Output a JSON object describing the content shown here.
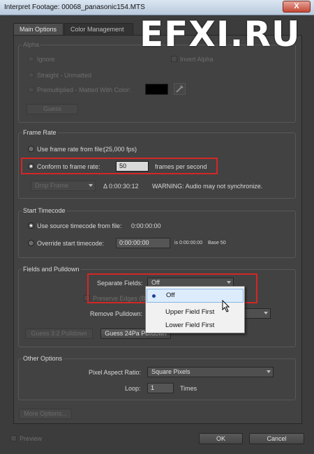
{
  "window": {
    "title": "Interpret Footage: 00068_panasonic154.MTS",
    "close_label": "X"
  },
  "watermark": "EFXI.RU",
  "tabs": [
    {
      "label": "Main Options",
      "active": true
    },
    {
      "label": "Color Management",
      "active": false
    }
  ],
  "alpha": {
    "title": "Alpha",
    "ignore": "Ignore",
    "invert": "Invert Alpha",
    "straight": "Straight - Unmatted",
    "premultiplied": "Premultiplied - Matted With Color:",
    "matte_color": "#000000",
    "guess": "Guess"
  },
  "frame_rate": {
    "title": "Frame Rate",
    "use_file": "Use frame rate from file:",
    "file_fps": "(25,000 fps)",
    "conform": "Conform to frame rate:",
    "conform_value": "50",
    "unit": "frames per second",
    "drop_frame": "Drop Frame",
    "delta": "Δ 0:00:30:12",
    "warning": "WARNING: Audio may not synchronize."
  },
  "start_timecode": {
    "title": "Start Timecode",
    "use_source": "Use source timecode from file:",
    "source_value": "0:00:00:00",
    "override": "Override start timecode:",
    "override_value": "0:00:00:00",
    "is_label": "is 0:00:00:00",
    "base_label": "Base 50"
  },
  "fields": {
    "title": "Fields and Pulldown",
    "separate_label": "Separate Fields:",
    "separate_value": "Off",
    "preserve_label": "Preserve Edges (B",
    "remove_label": "Remove Pulldown:",
    "guess32": "Guess 3:2 Pulldown",
    "guess24": "Guess 24Pa Pulldown",
    "menu_options": [
      "Off",
      "Upper Field First",
      "Lower Field First"
    ]
  },
  "other": {
    "title": "Other Options",
    "par_label": "Pixel Aspect Ratio:",
    "par_value": "Square Pixels",
    "loop_label": "Loop:",
    "loop_value": "1",
    "times": "Times"
  },
  "footer": {
    "more_options": "More Options...",
    "preview": "Preview",
    "ok": "OK",
    "cancel": "Cancel"
  },
  "colors": {
    "highlight_box": "#d42626",
    "menu_selection": "#dcecfc"
  }
}
